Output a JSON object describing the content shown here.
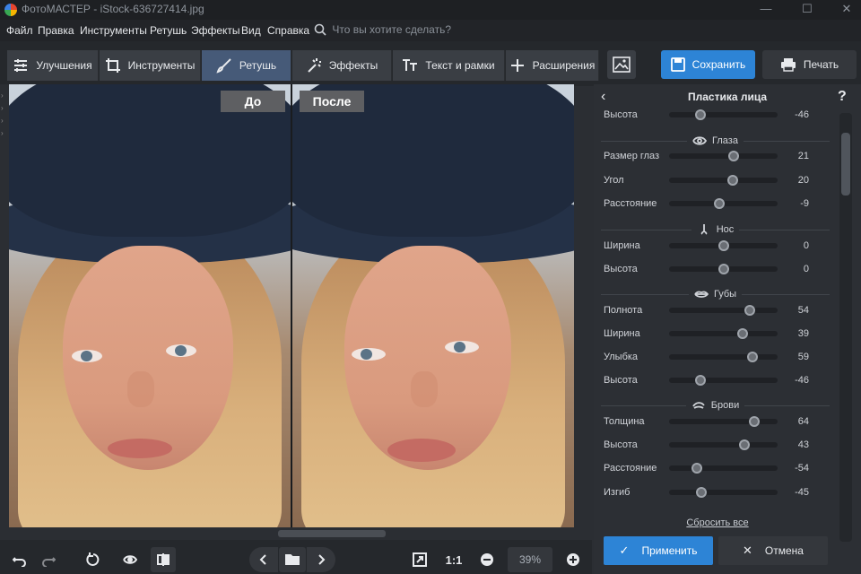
{
  "window": {
    "title": "ФотоМАСТЕР - iStock-636727414.jpg"
  },
  "menu": {
    "items": [
      "Файл",
      "Правка",
      "Инструменты",
      "Ретушь",
      "Эффекты",
      "Вид",
      "Справка"
    ],
    "search_placeholder": "Что вы хотите сделать?"
  },
  "tabs": [
    {
      "label": "Улучшения",
      "icon": "sliders-icon"
    },
    {
      "label": "Инструменты",
      "icon": "crop-icon"
    },
    {
      "label": "Ретушь",
      "icon": "brush-icon",
      "active": true
    },
    {
      "label": "Эффекты",
      "icon": "magic-wand-icon"
    },
    {
      "label": "Текст и рамки",
      "icon": "text-icon"
    },
    {
      "label": "Расширения",
      "icon": "plus-icon"
    }
  ],
  "actions": {
    "save_label": "Сохранить",
    "print_label": "Печать"
  },
  "compare": {
    "before_label": "До",
    "after_label": "После"
  },
  "bottom": {
    "zoom_ratio_label": "1:1",
    "zoom_value": "39%"
  },
  "panel": {
    "title": "Пластика лица",
    "sections": [
      {
        "name": "",
        "icon": "",
        "rows": [
          {
            "label": "Высота",
            "value": -46
          }
        ]
      },
      {
        "name": "Глаза",
        "icon": "eye-icon",
        "rows": [
          {
            "label": "Размер глаз",
            "value": 21
          },
          {
            "label": "Угол",
            "value": 20
          },
          {
            "label": "Расстояние",
            "value": -9
          }
        ]
      },
      {
        "name": "Нос",
        "icon": "nose-icon",
        "rows": [
          {
            "label": "Ширина",
            "value": 0
          },
          {
            "label": "Высота",
            "value": 0
          }
        ]
      },
      {
        "name": "Губы",
        "icon": "lips-icon",
        "rows": [
          {
            "label": "Полнота",
            "value": 54
          },
          {
            "label": "Ширина",
            "value": 39
          },
          {
            "label": "Улыбка",
            "value": 59
          },
          {
            "label": "Высота",
            "value": -46
          }
        ]
      },
      {
        "name": "Брови",
        "icon": "eyebrow-icon",
        "rows": [
          {
            "label": "Толщина",
            "value": 64
          },
          {
            "label": "Высота",
            "value": 43
          },
          {
            "label": "Расстояние",
            "value": -54
          },
          {
            "label": "Изгиб",
            "value": -45
          }
        ]
      }
    ],
    "reset_label": "Сбросить все",
    "apply_label": "Применить",
    "cancel_label": "Отмена"
  },
  "colors": {
    "accent": "#2d84d6",
    "active_tab": "#465a78",
    "background": "#2b2e33"
  }
}
